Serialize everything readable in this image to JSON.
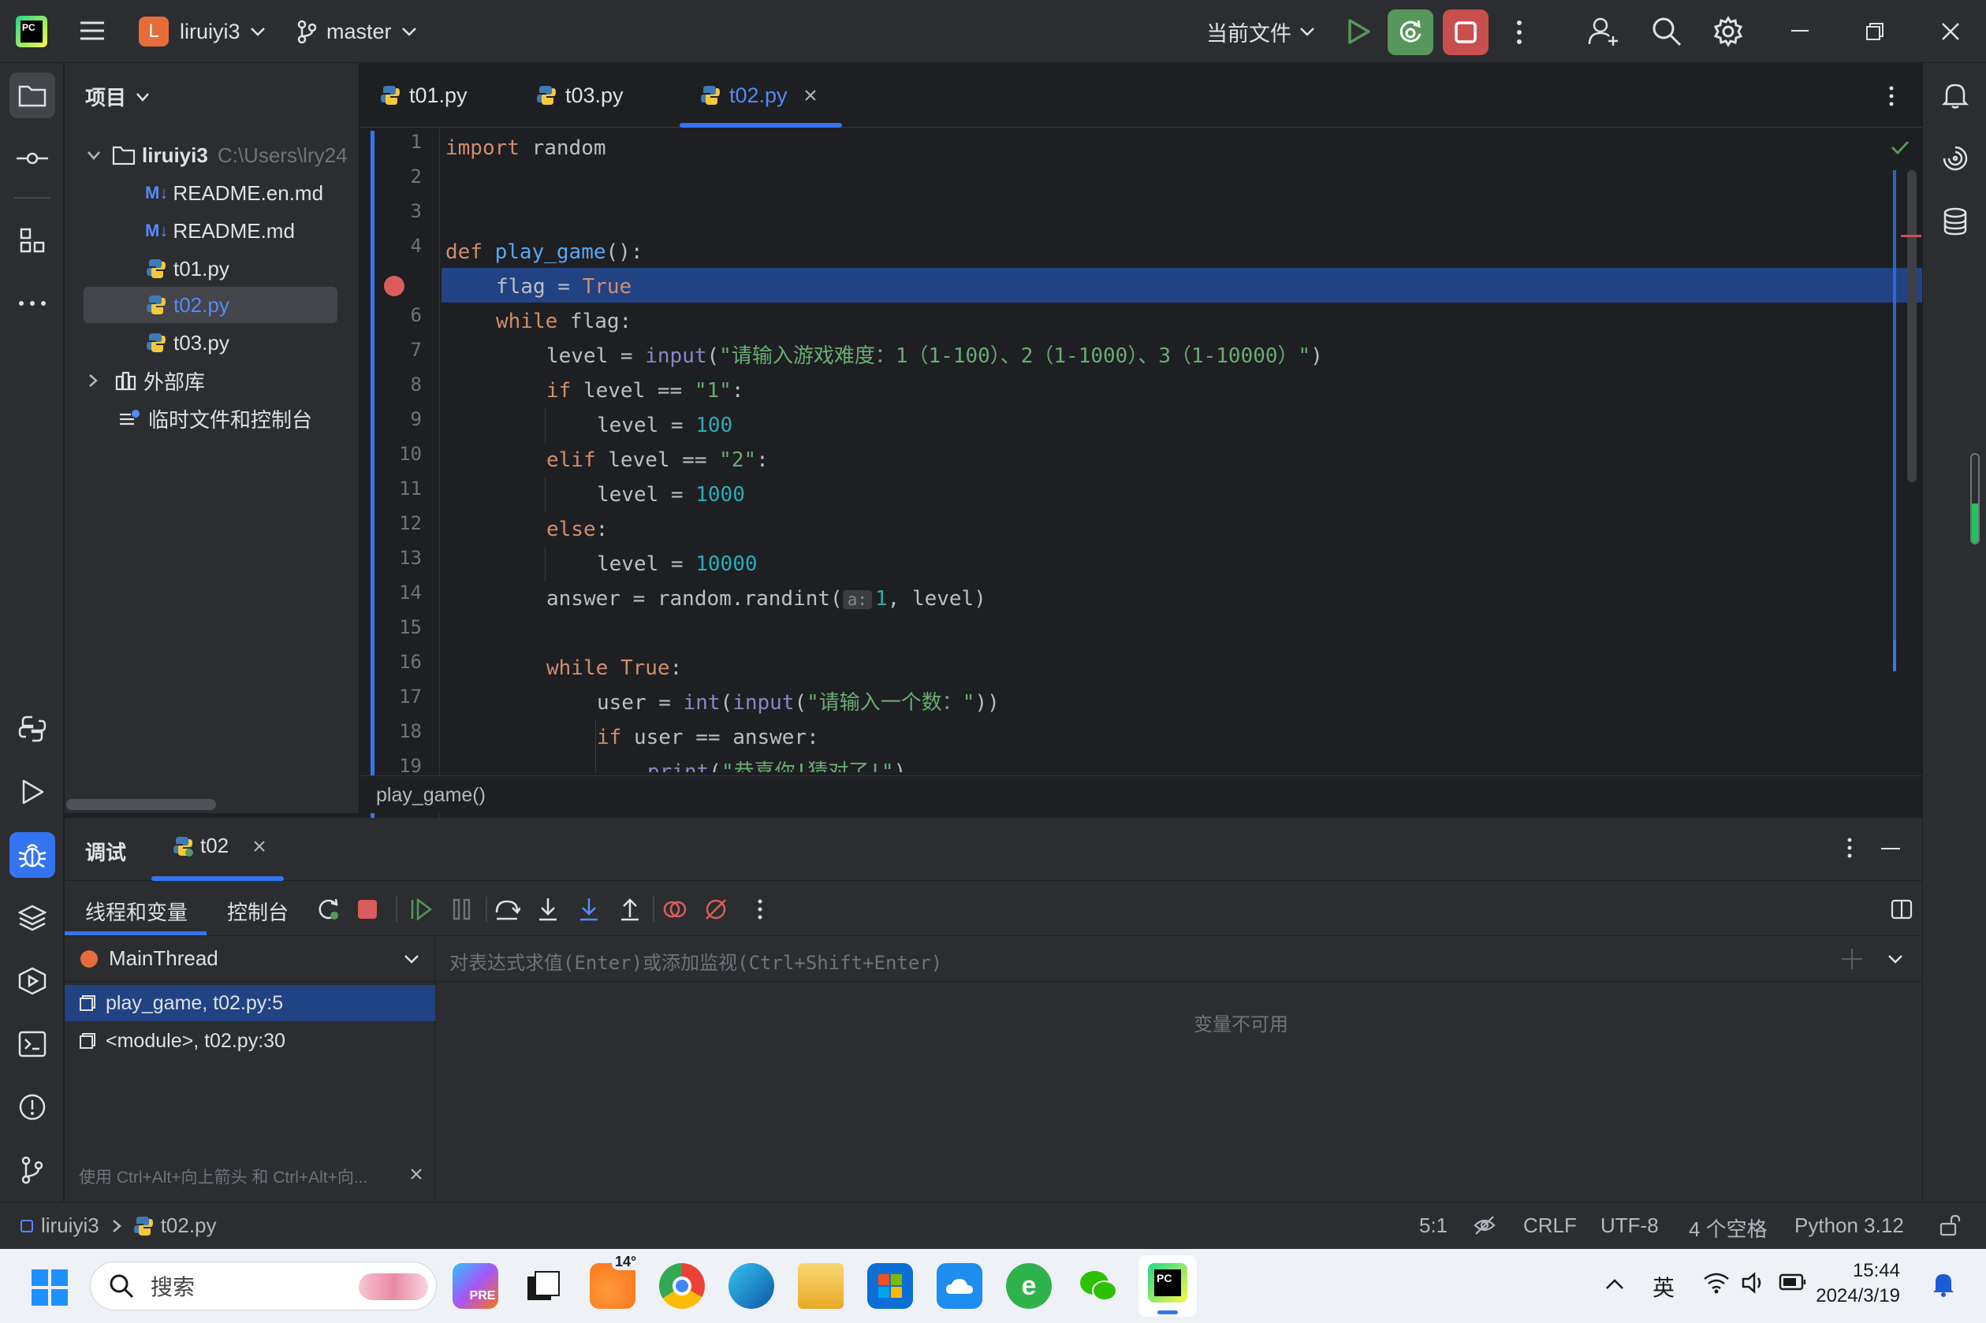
{
  "titlebar": {
    "project_initial": "L",
    "project_name": "liruiyi3",
    "branch": "master",
    "run_config": "当前文件"
  },
  "project_panel": {
    "title": "项目",
    "root_name": "liruiyi3",
    "root_path": "C:\\Users\\lry24",
    "files": [
      {
        "name": "README.en.md",
        "kind": "md"
      },
      {
        "name": "README.md",
        "kind": "md"
      },
      {
        "name": "t01.py",
        "kind": "py"
      },
      {
        "name": "t02.py",
        "kind": "py"
      },
      {
        "name": "t03.py",
        "kind": "py"
      }
    ],
    "external_libs": "外部库",
    "scratches": "临时文件和控制台"
  },
  "editor": {
    "tabs": [
      {
        "label": "t01.py"
      },
      {
        "label": "t03.py"
      },
      {
        "label": "t02.py"
      }
    ],
    "line_numbers": [
      "1",
      "2",
      "3",
      "4",
      "5",
      "6",
      "7",
      "8",
      "9",
      "10",
      "11",
      "12",
      "13",
      "14",
      "15",
      "16",
      "17",
      "18",
      "19"
    ],
    "breadcrumb": "play_game()",
    "param_hint": "a:"
  },
  "code": {
    "l1_kw": "import",
    "l1_rest": " random",
    "l4_kw": "def",
    "l4_fn": "play_game",
    "l4_rest": "():",
    "l5_a": "flag = ",
    "l5_b": "True",
    "l6_kw": "while",
    "l6_rest": " flag:",
    "l7_a": "level = ",
    "l7_fn": "input",
    "l7_b": "(",
    "l7_str": "\"请输入游戏难度：1（1-100）、2（1-1000）、3（1-10000）\"",
    "l7_c": ")",
    "l8_kw": "if",
    "l8_a": " level == ",
    "l8_str": "\"1\"",
    "l8_b": ":",
    "l9_a": "level = ",
    "l9_num": "100",
    "l10_kw": "elif",
    "l10_a": " level == ",
    "l10_str": "\"2\"",
    "l10_b": ":",
    "l11_a": "level = ",
    "l11_num": "1000",
    "l12_kw": "else",
    "l12_a": ":",
    "l13_a": "level = ",
    "l13_num": "10000",
    "l14_a": "answer = random.randint(",
    "l14_num": "1",
    "l14_b": ", level)",
    "l16_kw": "while",
    "l16_b": "True",
    "l16_c": ":",
    "l17_a": "user = ",
    "l17_fn1": "int",
    "l17_b": "(",
    "l17_fn2": "input",
    "l17_c": "(",
    "l17_str": "\"请输入一个数：\"",
    "l17_d": "))",
    "l18_kw": "if",
    "l18_a": " user == answer:",
    "l19_fn": "print",
    "l19_a": "(",
    "l19_str": "\"恭喜你!猜对了!\"",
    "l19_b": ")"
  },
  "debug": {
    "title": "调试",
    "session_tab": "t02",
    "subtab_threads": "线程和变量",
    "subtab_console": "控制台",
    "thread": "MainThread",
    "frames": [
      "play_game, t02.py:5",
      "<module>, t02.py:30"
    ],
    "eval_placeholder": "对表达式求值(Enter)或添加监视(Ctrl+Shift+Enter)",
    "vars_unavailable": "变量不可用",
    "hint": "使用 Ctrl+Alt+向上箭头 和 Ctrl+Alt+向..."
  },
  "statusbar": {
    "crumb_project": "liruiyi3",
    "crumb_file": "t02.py",
    "position": "5:1",
    "line_sep": "CRLF",
    "encoding": "UTF-8",
    "indent": "4 个空格",
    "interpreter": "Python 3.12"
  },
  "taskbar": {
    "search": "搜索",
    "weather": "14°",
    "ime": "英",
    "time": "15:44",
    "date": "2024/3/19"
  },
  "colors": {
    "accent": "#3574f0",
    "run_green": "#57965c",
    "stop_red": "#c94f4f",
    "breakpoint": "#db5c5c",
    "selection": "#214283"
  }
}
